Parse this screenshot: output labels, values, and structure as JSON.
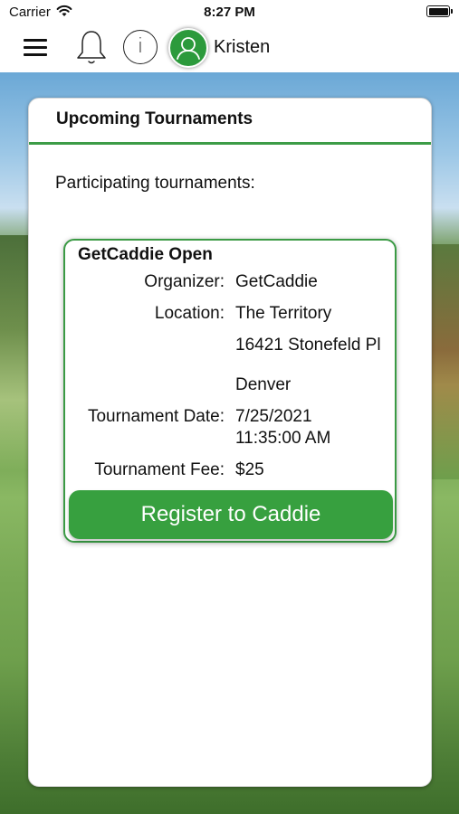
{
  "status_bar": {
    "carrier": "Carrier",
    "time": "8:27 PM"
  },
  "nav": {
    "username": "Kristen",
    "icons": [
      "menu-icon",
      "bell-icon",
      "info-icon",
      "avatar-icon"
    ],
    "accent_color": "#2c9a3c"
  },
  "card": {
    "title": "Upcoming Tournaments",
    "subtitle": "Participating tournaments:"
  },
  "tournament": {
    "name": "GetCaddie Open",
    "organizer_label": "Organizer:",
    "organizer": "GetCaddie",
    "location_label": "Location:",
    "location_line1": "The Territory",
    "location_line2": "16421 Stonefeld Pl",
    "location_line3": "Denver",
    "date_label": "Tournament Date:",
    "date_line1": "7/25/2021",
    "date_line2": "11:35:00 AM",
    "fee_label": "Tournament Fee:",
    "fee": "$25",
    "register_label": "Register to Caddie"
  }
}
